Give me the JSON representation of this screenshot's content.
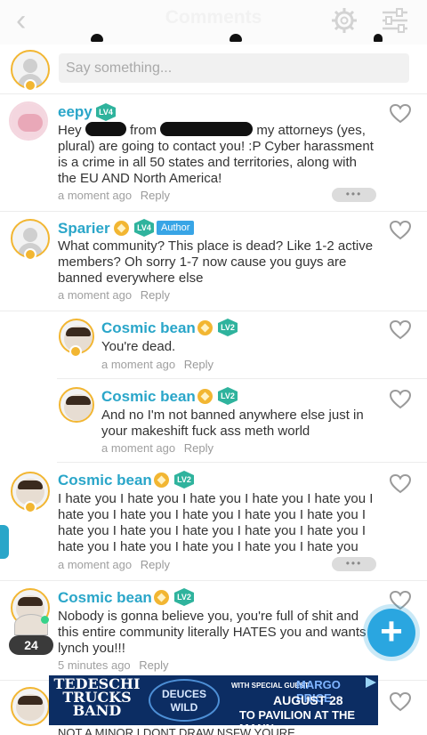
{
  "header": {
    "title": "Comments",
    "back_icon": "chevron-left-icon",
    "settings_icon": "gear-icon",
    "filter_icon": "sliders-icon"
  },
  "compose": {
    "placeholder": "Say something..."
  },
  "comments": [
    {
      "name": "eepy",
      "level": "LV4",
      "author": "",
      "text_pre": "Hey",
      "text_mid": "from",
      "text_post": "my attorneys (yes, plural) are going to contact you! :P  Cyber harassment is a crime in all 50 states and territories, along with the EU AND North America!",
      "time": "a moment ago",
      "reply": "Reply",
      "more": "•••"
    },
    {
      "name": "Sparier",
      "level": "LV4",
      "author": "Author",
      "text": "What community? This place is dead? Like 1-2 active members? Oh sorry 1-7 now cause you guys are banned everywhere else",
      "time": "a moment ago",
      "reply": "Reply"
    },
    {
      "name": "Cosmic bean",
      "level": "LV2",
      "text": "You're dead.",
      "time": "a moment ago",
      "reply": "Reply"
    },
    {
      "name": "Cosmic bean",
      "level": "LV2",
      "text": "And no I'm not banned anywhere else just in your makeshift fuck ass meth world",
      "time": "a moment ago",
      "reply": "Reply"
    },
    {
      "name": "Cosmic bean",
      "level": "LV2",
      "text": "I hate you I hate you I hate you I hate you I hate you I hate you I hate you I hate you I hate you I hate you I hate you I hate you I hate you I hate you I hate you I hate you I hate you I hate you I hate you I hate you",
      "time": "a moment ago",
      "reply": "Reply",
      "more": "•••"
    },
    {
      "name": "Cosmic bean",
      "level": "LV2",
      "text": "Nobody is gonna believe you, you're full of shit and this entire community literally HATES you and wants to lynch you!!!",
      "time": "5 minutes ago",
      "reply": "Reply"
    }
  ],
  "online_count": "24",
  "fab_label": "+",
  "ad": {
    "band": "TEDESCHI TRUCKS BAND",
    "deuces": "DEUCES WILD",
    "special": "WITH SPECIAL GUEST",
    "margo": "MARGO PRICE",
    "date": "AUGUST 28",
    "venue": "TO PAVILION AT THE MANN"
  },
  "footer_text": "NOT A MINOR I DONT DRAW NSFW YOURE"
}
